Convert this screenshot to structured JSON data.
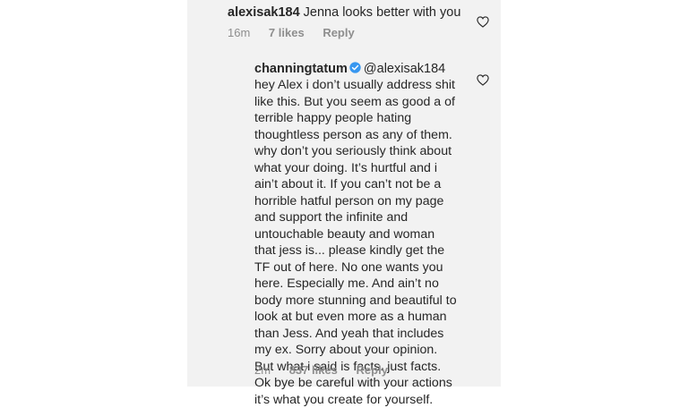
{
  "top_comment": {
    "username": "alexisak184",
    "text": "Jenna looks better with you",
    "time": "16m",
    "likes": "7 likes",
    "reply_label": "Reply"
  },
  "reply": {
    "username": "channingtatum",
    "verified": true,
    "mention": "@alexisak184",
    "lines": [
      "hey Alex i don’t usually address shit",
      "like this. But you seem as good a of",
      "terrible happy people hating",
      "thoughtless person as any of them.",
      "why don’t you seriously think about",
      "what your doing. It’s hurtful and i",
      "ain’t about it. If you can’t not be a",
      "horrible hatful person on my page",
      "and support the infinite and",
      "untouchable beauty and woman",
      "that jess is... please kindly get the",
      "TF out of here. No one wants you",
      "here. Especially me. And ain’t no",
      "body more stunning and beautiful to",
      "look at but even more as a human",
      "than Jess. And yeah that includes",
      "my ex. Sorry about your opinion.",
      "But what i said is facts. just facts.",
      "Ok bye be careful with your actions",
      "it’s what you create for yourself."
    ],
    "time": "2m",
    "likes": "837 likes",
    "reply_label": "Reply"
  },
  "icons": {
    "like": "heart-outline-icon",
    "verified": "verified-badge-icon"
  },
  "colors": {
    "panel_bg": "#f2f2f2",
    "text": "#262626",
    "meta": "#8e8e8e",
    "verified_blue": "#3897f0"
  }
}
